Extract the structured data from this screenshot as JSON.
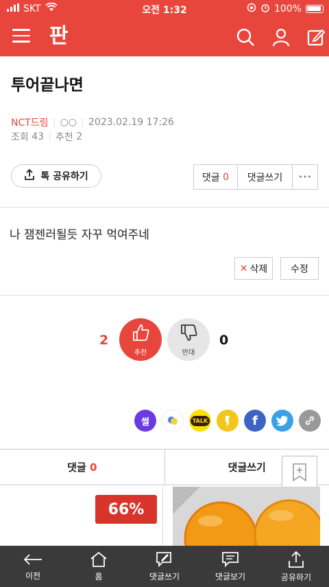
{
  "status": {
    "carrier": "SKT",
    "time": "오전 1:32",
    "battery": "100%"
  },
  "header": {
    "logo": "판"
  },
  "post": {
    "title": "투어끝나면",
    "author": "NCT드림",
    "author_extra": "○○",
    "datetime": "2023.02.19 17:26",
    "views_label": "조회",
    "views": "43",
    "recommend_label": "추천",
    "recommend": "2",
    "body": "나 잼젠러될듯 자꾸 먹여주네"
  },
  "actions": {
    "share_label": "톡 공유하기",
    "comment_label": "댓글",
    "comment_count": "0",
    "write_comment": "댓글쓰기",
    "more": "•••",
    "delete": "삭제",
    "edit": "수정"
  },
  "votes": {
    "up_count": "2",
    "up_label": "추천",
    "down_label": "반대",
    "down_count": "0"
  },
  "share_icons": [
    "ssul",
    "band",
    "kakaotalk",
    "kakaostory",
    "facebook",
    "twitter",
    "link"
  ],
  "share_text": {
    "ssul": "썰",
    "talk": "TALK",
    "facebook": "f"
  },
  "tabs": {
    "comment_label": "댓글",
    "comment_count": "0",
    "write": "댓글쓰기"
  },
  "ad": {
    "discount": "66%"
  },
  "bottom_nav": [
    "이전",
    "홈",
    "댓글쓰기",
    "댓글보기",
    "공유하기"
  ],
  "colors": {
    "brand": "#e8463c",
    "dark": "#3a3a3a"
  }
}
